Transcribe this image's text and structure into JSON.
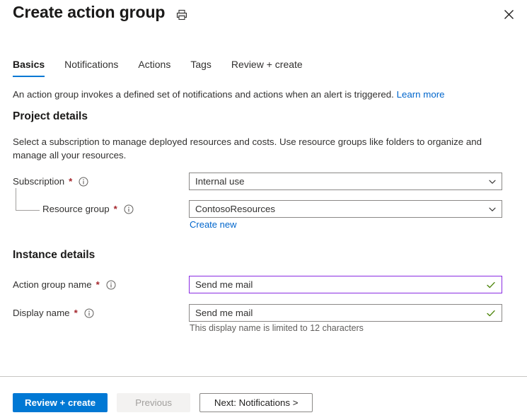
{
  "header": {
    "title": "Create action group",
    "print_icon": "printer-icon",
    "close_icon": "close-icon"
  },
  "tabs": [
    {
      "label": "Basics",
      "active": true
    },
    {
      "label": "Notifications",
      "active": false
    },
    {
      "label": "Actions",
      "active": false
    },
    {
      "label": "Tags",
      "active": false
    },
    {
      "label": "Review + create",
      "active": false
    }
  ],
  "intro": {
    "text": "An action group invokes a defined set of notifications and actions when an alert is triggered.",
    "link_label": "Learn more"
  },
  "project_details": {
    "title": "Project details",
    "description": "Select a subscription to manage deployed resources and costs. Use resource groups like folders to organize and manage all your resources.",
    "subscription": {
      "label": "Subscription",
      "required_marker": "*",
      "value": "Internal use",
      "icon": "info-icon",
      "chevron": "chevron-down-icon"
    },
    "resource_group": {
      "label": "Resource group",
      "required_marker": "*",
      "value": "ContosoResources",
      "icon": "info-icon",
      "chevron": "chevron-down-icon",
      "create_new_label": "Create new"
    }
  },
  "instance_details": {
    "title": "Instance details",
    "action_group_name": {
      "label": "Action group name",
      "required_marker": "*",
      "value": "Send me mail",
      "placeholder": "",
      "icon": "info-icon",
      "validation_icon": "checkmark-icon",
      "focused": true
    },
    "display_name": {
      "label": "Display name",
      "required_marker": "*",
      "value": "Send me mail",
      "placeholder": "",
      "icon": "info-icon",
      "validation_icon": "checkmark-icon",
      "helper_text": "This display name is limited to 12 characters",
      "focused": false
    }
  },
  "footer": {
    "review_create_label": "Review + create",
    "previous_label": "Previous",
    "next_label": "Next: Notifications >"
  },
  "colors": {
    "accent_blue": "#0078d4",
    "link_blue": "#0066cc",
    "required_red": "#a4262c",
    "focus_purple": "#8a2be2",
    "valid_green": "#498205",
    "border_gray": "#8a8886"
  }
}
